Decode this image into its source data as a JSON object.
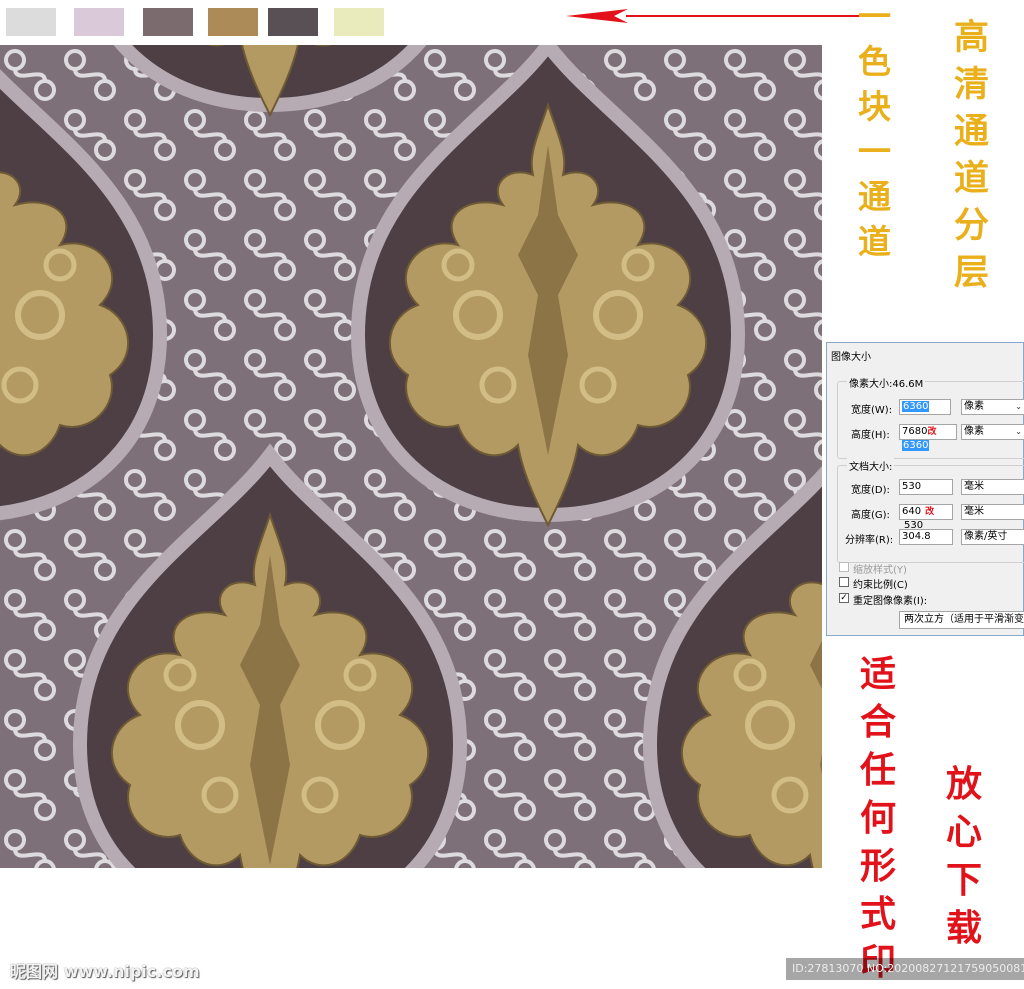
{
  "swatches": [
    {
      "name": "swatch-light-gray",
      "color": "#dcdcdc"
    },
    {
      "name": "swatch-lilac",
      "color": "#d9c9d9"
    },
    {
      "name": "swatch-mauve",
      "color": "#7b6b6e"
    },
    {
      "name": "swatch-gold",
      "color": "#ad8b59"
    },
    {
      "name": "swatch-dark-gray",
      "color": "#585054"
    },
    {
      "name": "swatch-pale-yellow",
      "color": "#eaebbd"
    }
  ],
  "annotations": {
    "one_swatch_one_channel": [
      "一",
      "色",
      "块",
      "一",
      "通",
      "道"
    ],
    "hd_channel_layers": [
      "高",
      "清",
      "通",
      "道",
      "分",
      "层"
    ],
    "suitable_any_print": [
      "适",
      "合",
      "任",
      "何",
      "形",
      "式",
      "印"
    ],
    "safe_download": [
      "放",
      "心",
      "下",
      "载"
    ]
  },
  "dialog": {
    "title": "图像大小",
    "pixel_dimensions_label": "像素大小:46.6M",
    "width_label": "宽度(W):",
    "width_value": "6360",
    "width_unit": "像素",
    "height_label": "高度(H):",
    "height_value_old": "7680",
    "height_change_mark": "改",
    "height_value_new": "6360",
    "height_unit": "像素",
    "document_size_label": "文档大小:",
    "doc_width_label": "宽度(D):",
    "doc_width_value": "530",
    "doc_width_unit": "毫米",
    "doc_height_label": "高度(G):",
    "doc_height_value": "640",
    "doc_height_change_mark": "改",
    "doc_height_new": "530",
    "doc_height_unit": "毫米",
    "resolution_label": "分辨率(R):",
    "resolution_value": "304.8",
    "resolution_unit": "像素/英寸",
    "scale_styles_label": "缩放样式(Y)",
    "constrain_label": "约束比例(C)",
    "resample_label": "重定图像像素(I):",
    "resample_method": "两次立方（适用于平滑渐变"
  },
  "watermark": {
    "logo_text": "昵图网 www.nipic.com",
    "id_text": "ID:27813070 NO:20200827121759050081"
  },
  "colors": {
    "annotation_gold": "#e9b01b",
    "annotation_red": "#e2121a",
    "pattern_background": "#7e7079",
    "pattern_gold": "#b39a63",
    "pattern_dark": "#4d3f44",
    "pattern_white": "#e9e7ea"
  }
}
